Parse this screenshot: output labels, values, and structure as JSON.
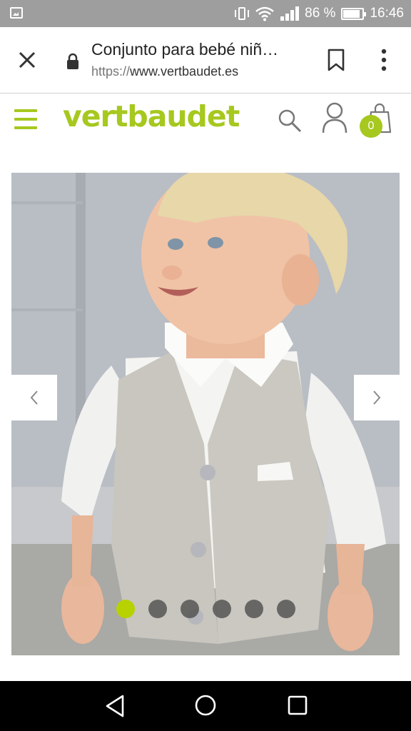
{
  "status_bar": {
    "battery_percent": "86 %",
    "time": "16:46",
    "icons": [
      "gallery-icon",
      "vibrate-icon",
      "wifi-icon",
      "signal-icon",
      "battery-icon"
    ]
  },
  "browser": {
    "page_title": "Conjunto para bebé niñ…",
    "url_scheme": "https://",
    "url_host": "www.vertbaudet.es",
    "icons": [
      "close-icon",
      "lock-icon",
      "bookmark-icon",
      "more-vert-icon"
    ]
  },
  "site": {
    "logo_text": "vertbaudet",
    "brand_color": "#a6c81f",
    "cart_count": "0",
    "icons": [
      "menu-icon",
      "search-icon",
      "user-icon",
      "cart-icon"
    ]
  },
  "carousel": {
    "image_count": 6,
    "active_index": 0,
    "icons": [
      "chevron-left-icon",
      "chevron-right-icon"
    ]
  },
  "system_nav": {
    "icons": [
      "back-icon",
      "home-icon",
      "recents-icon"
    ]
  }
}
